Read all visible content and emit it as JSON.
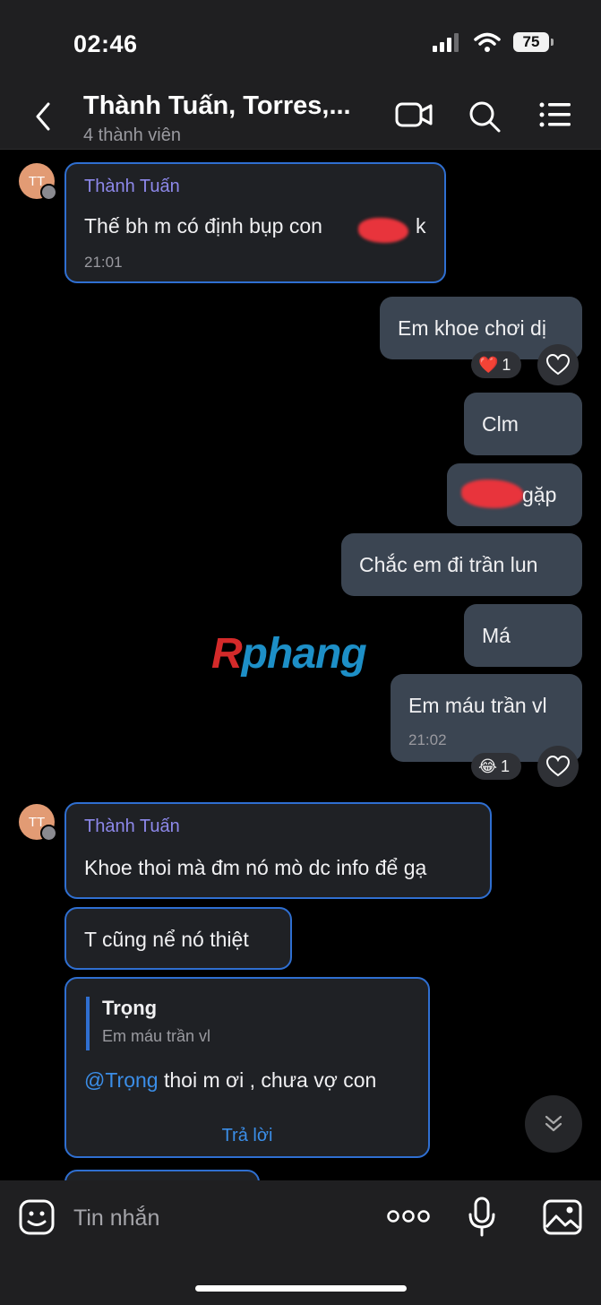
{
  "status": {
    "time": "02:46",
    "battery": "75"
  },
  "header": {
    "title": "Thành Tuấn, Torres,...",
    "subtitle": "4 thành viên"
  },
  "messages": {
    "m1": {
      "sender": "Thành Tuấn",
      "text_before": "Thế bh m có định bụp con",
      "text_after": "k",
      "time": "21:01",
      "avatar": "TT"
    },
    "m2": {
      "text": "Em khoe chơi dị",
      "reaction_emoji": "❤️",
      "reaction_count": "1"
    },
    "m3": {
      "text": "Clm"
    },
    "m4": {
      "text": "gặp"
    },
    "m5": {
      "text": "Chắc em đi trần lun"
    },
    "m6": {
      "text": "Má"
    },
    "m7": {
      "text": "Em máu trần vl",
      "time": "21:02",
      "reaction_emoji": "😂",
      "reaction_count": "1"
    },
    "m8": {
      "sender": "Thành Tuấn",
      "text": "Khoe thoi mà đm nó mò dc info để gạ",
      "avatar": "TT"
    },
    "m9": {
      "text": "T cũng nể nó thiệt"
    },
    "m10": {
      "quote_name": "Trọng",
      "quote_text": "Em máu trần vl",
      "mention": "@Trọng",
      "text": " thoi m ơi , chưa vợ con",
      "reply_label": "Trả lời"
    }
  },
  "watermark": {
    "first": "R",
    "rest": "phang"
  },
  "composer": {
    "placeholder": "Tin nhắn"
  },
  "colors": {
    "accent": "#2f6fd1",
    "sender": "#8d88ea",
    "link": "#3b8ee8",
    "outgoing": "#3b4552"
  }
}
